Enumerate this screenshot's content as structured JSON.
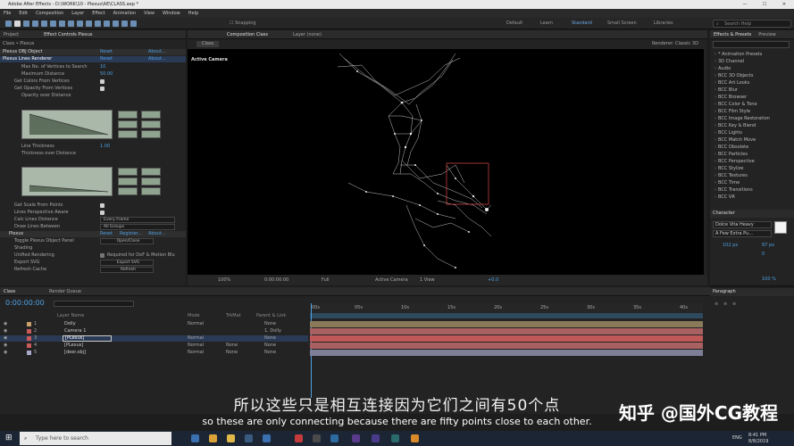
{
  "window": {
    "title": "Adobe After Effects - D:\\WORK\\10 - Plexus\\AE\\CLASS.aep *"
  },
  "menu": [
    "File",
    "Edit",
    "Composition",
    "Layer",
    "Effect",
    "Animation",
    "View",
    "Window",
    "Help"
  ],
  "toolbar": {
    "snapping": "Snapping",
    "workspaces": [
      "Default",
      "Learn",
      "Standard",
      "Small Screen",
      "Libraries"
    ],
    "search": "Search Help"
  },
  "left": {
    "tabs": [
      "Project",
      "Effect Controls Plexus"
    ],
    "breadcrumb": "Class • Plexus",
    "effects": [
      {
        "name": "Plexus OBJ Object",
        "reset": "Reset",
        "about": "About..."
      },
      {
        "name": "Plexus Lines Renderer",
        "reset": "Reset",
        "about": "About..."
      }
    ],
    "props": [
      {
        "label": "Max No. of Vertices to Search",
        "value": "10"
      },
      {
        "label": "Maximum Distance",
        "value": "50.00"
      },
      {
        "label": "Get Colors From Vertices",
        "value": ""
      },
      {
        "label": "Get Opacity From Vertices",
        "value": ""
      },
      {
        "label": "Opacity over Distance",
        "value": ""
      },
      {
        "label": "Line Thickness",
        "value": "1.00"
      },
      {
        "label": "Thickness over Distance",
        "value": ""
      },
      {
        "label": "Get Scale From Points",
        "value": ""
      },
      {
        "label": "Lines Perspective Aware",
        "value": ""
      },
      {
        "label": "Calc Lines Distance",
        "value": "Every Frame"
      },
      {
        "label": "Draw Lines Between",
        "value": "All Groups"
      }
    ],
    "plexus": {
      "name": "Plexus",
      "reset": "Reset",
      "register": "Register...",
      "about": "About..."
    },
    "plexus_props": [
      {
        "label": "Toggle Plexus Object Panel",
        "value": "Open/Close"
      },
      {
        "label": "Shading",
        "value": ""
      },
      {
        "label": "Unified Rendering",
        "value": "Required for DoF & Motion Blu"
      },
      {
        "label": "Export SVG",
        "value": "Export SVG"
      },
      {
        "label": "Refresh Cache",
        "value": "Refresh"
      }
    ]
  },
  "comp": {
    "tab": "Composition Class",
    "layer_tab": "Layer (none)",
    "subtab": "Class",
    "renderer": "Renderer: Classic 3D",
    "camera_label": "Active Camera",
    "footer": {
      "zoom": "100%",
      "time": "0:00:00:00",
      "quality": "Full",
      "camera": "Active Camera",
      "view": "1 View",
      "exposure": "+0.0"
    }
  },
  "right": {
    "tabs": [
      "Effects & Presets",
      "Preview"
    ],
    "effects": [
      "* Animation Presets",
      "3D Channel",
      "Audio",
      "BCC 3D Objects",
      "BCC Art Looks",
      "BCC Blur",
      "BCC Browser",
      "BCC Color & Tone",
      "BCC Film Style",
      "BCC Image Restoration",
      "BCC Key & Blend",
      "BCC Lights",
      "BCC Match Move",
      "BCC Obsolete",
      "BCC Particles",
      "BCC Perspective",
      "BCC Stylize",
      "BCC Textures",
      "BCC Time",
      "BCC Transitions",
      "BCC VR"
    ],
    "character_tab": "Character",
    "font": "Dolce Vita Heavy",
    "style": "A Few Extra Pu...",
    "size": "102 px",
    "leading": "87 px",
    "tracking": "0",
    "paragraph_tab": "Paragraph",
    "scale": "100 %"
  },
  "timeline": {
    "tabs": [
      "Class",
      "Render Queue"
    ],
    "timecode": "0:00:00:00",
    "headers": {
      "layer": "Layer Name",
      "mode": "Mode",
      "trkmat": "TrkMat",
      "parent": "Parent & Link"
    },
    "ruler": [
      "00s",
      "05s",
      "10s",
      "15s",
      "20s",
      "25s",
      "30s",
      "35s",
      "40s"
    ],
    "layers": [
      {
        "num": "1",
        "name": "Dolly",
        "mode": "Normal",
        "trkmat": "",
        "parent": "None",
        "color": "#c9a26a"
      },
      {
        "num": "2",
        "name": "Camera 1",
        "mode": "",
        "trkmat": "",
        "parent": "1. Dolly",
        "color": "#c95a5a"
      },
      {
        "num": "3",
        "name": "[PLexus]",
        "mode": "Normal",
        "trkmat": "",
        "parent": "None",
        "color": "#c95a5a"
      },
      {
        "num": "4",
        "name": "[PLexus]",
        "mode": "Normal",
        "trkmat": "None",
        "parent": "None",
        "color": "#c95a5a"
      },
      {
        "num": "5",
        "name": "[deer.obj]",
        "mode": "Normal",
        "trkmat": "None",
        "parent": "None",
        "color": "#a9a9c9"
      }
    ]
  },
  "subtitle": {
    "zh": "所以这些只是相互连接因为它们之间有50个点",
    "en": "so these are only connecting because there are fifty points close to each other."
  },
  "watermark": "知乎 @国外CG教程",
  "taskbar": {
    "search": "Type here to search",
    "time": "8:41 PM",
    "date": "8/8/2019",
    "lang": "ENG"
  }
}
